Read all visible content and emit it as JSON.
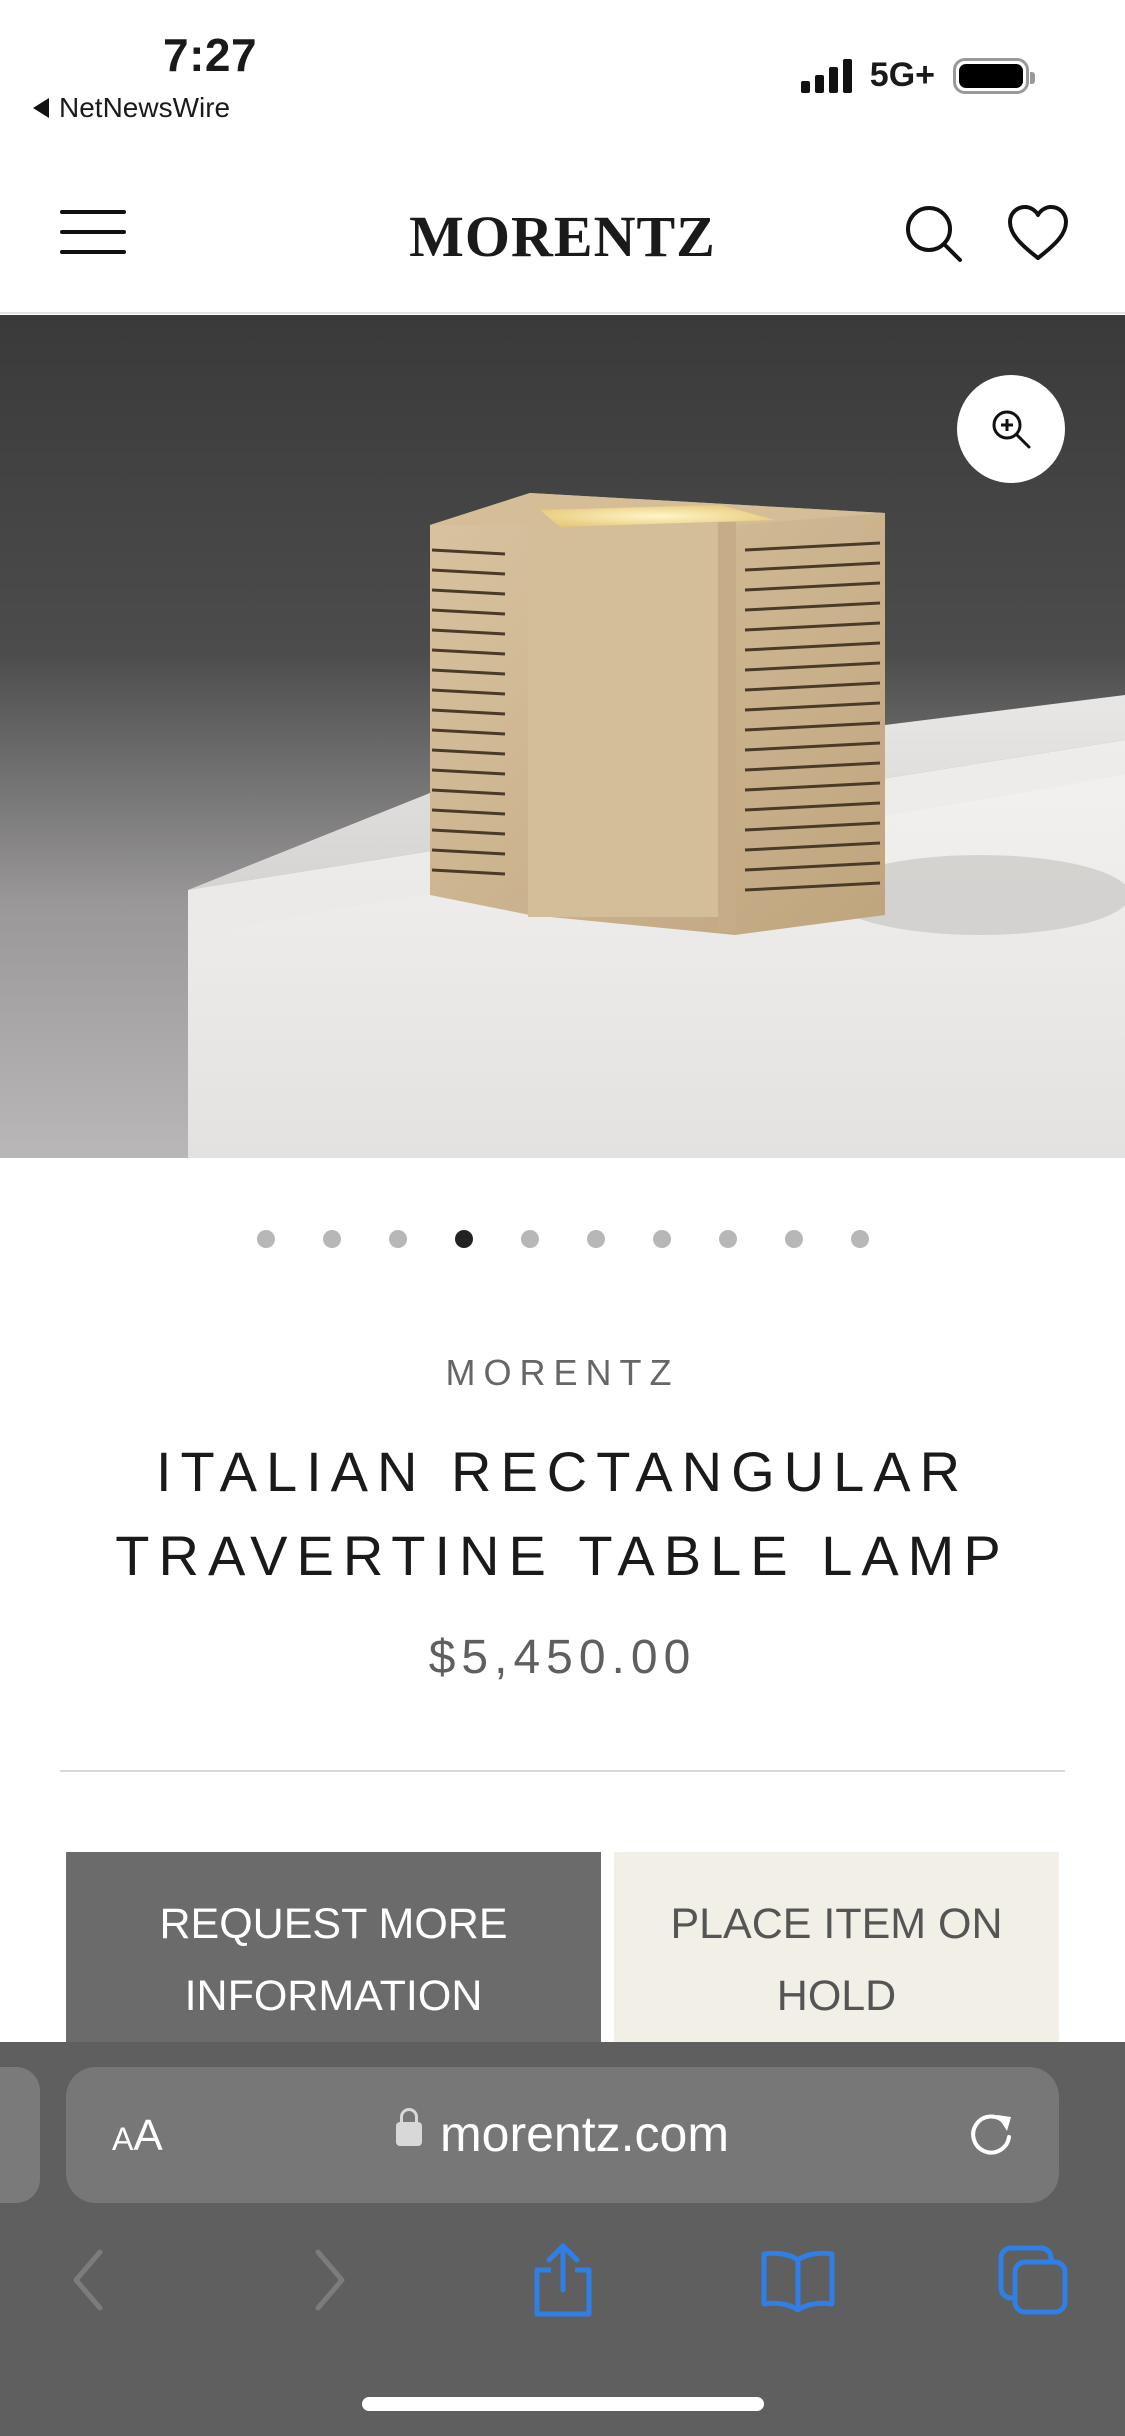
{
  "status_bar": {
    "time": "7:27",
    "back_app": "NetNewsWire",
    "network": "5G+"
  },
  "header": {
    "logo": "MORENTZ",
    "icons": [
      "menu-icon",
      "search-icon",
      "heart-icon"
    ]
  },
  "gallery": {
    "image_count": 10,
    "active_index": 3,
    "zoom_icon": "zoom-in-icon"
  },
  "product": {
    "brand": "MORENTZ",
    "title_line1": "ITALIAN RECTANGULAR",
    "title_line2": "TRAVERTINE TABLE LAMP",
    "price": "$5,450.00"
  },
  "actions": {
    "request_line1": "REQUEST MORE",
    "request_line2": "INFORMATION",
    "hold_line1": "PLACE ITEM ON",
    "hold_line2": "HOLD"
  },
  "browser": {
    "text_size": "AA",
    "url": "morentz.com",
    "toolbar_icons": [
      "back-icon",
      "forward-icon",
      "share-icon",
      "bookmarks-icon",
      "tabs-icon"
    ]
  },
  "colors": {
    "accent_blue": "#2f7fe6",
    "info_button": "#6b6b6b",
    "hold_button": "#f2efe6"
  }
}
